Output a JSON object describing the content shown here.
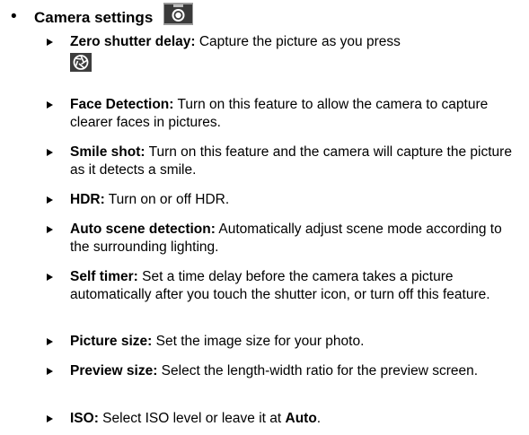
{
  "section": {
    "title": "Camera settings",
    "icon": "camera-icon"
  },
  "items": [
    {
      "term": "Zero shutter delay:",
      "desc": " Capture the picture as you press",
      "icon": "shutter-icon"
    },
    {
      "term": "Face Detection:",
      "desc": " Turn on this feature to allow the camera to capture clearer faces in pictures."
    },
    {
      "term": "Smile shot:",
      "desc": " Turn on this feature and the camera will capture the picture as it detects a smile."
    },
    {
      "term": "HDR:",
      "desc": " Turn on or off HDR."
    },
    {
      "term": "Auto scene detection:",
      "desc": " Automatically adjust scene mode according to the surrounding lighting."
    },
    {
      "term": "Self timer:",
      "desc": " Set a time delay before the camera takes a picture automatically after you touch the shutter icon, or turn off this feature."
    },
    {
      "term": "Picture size:",
      "desc": " Set the image size for your photo."
    },
    {
      "term": "Preview size:",
      "desc": " Select the length-width ratio for the preview screen."
    },
    {
      "term": "ISO:",
      "desc": " Select ISO level or leave it at ",
      "desc_bold": "Auto",
      "desc_end": "."
    }
  ]
}
